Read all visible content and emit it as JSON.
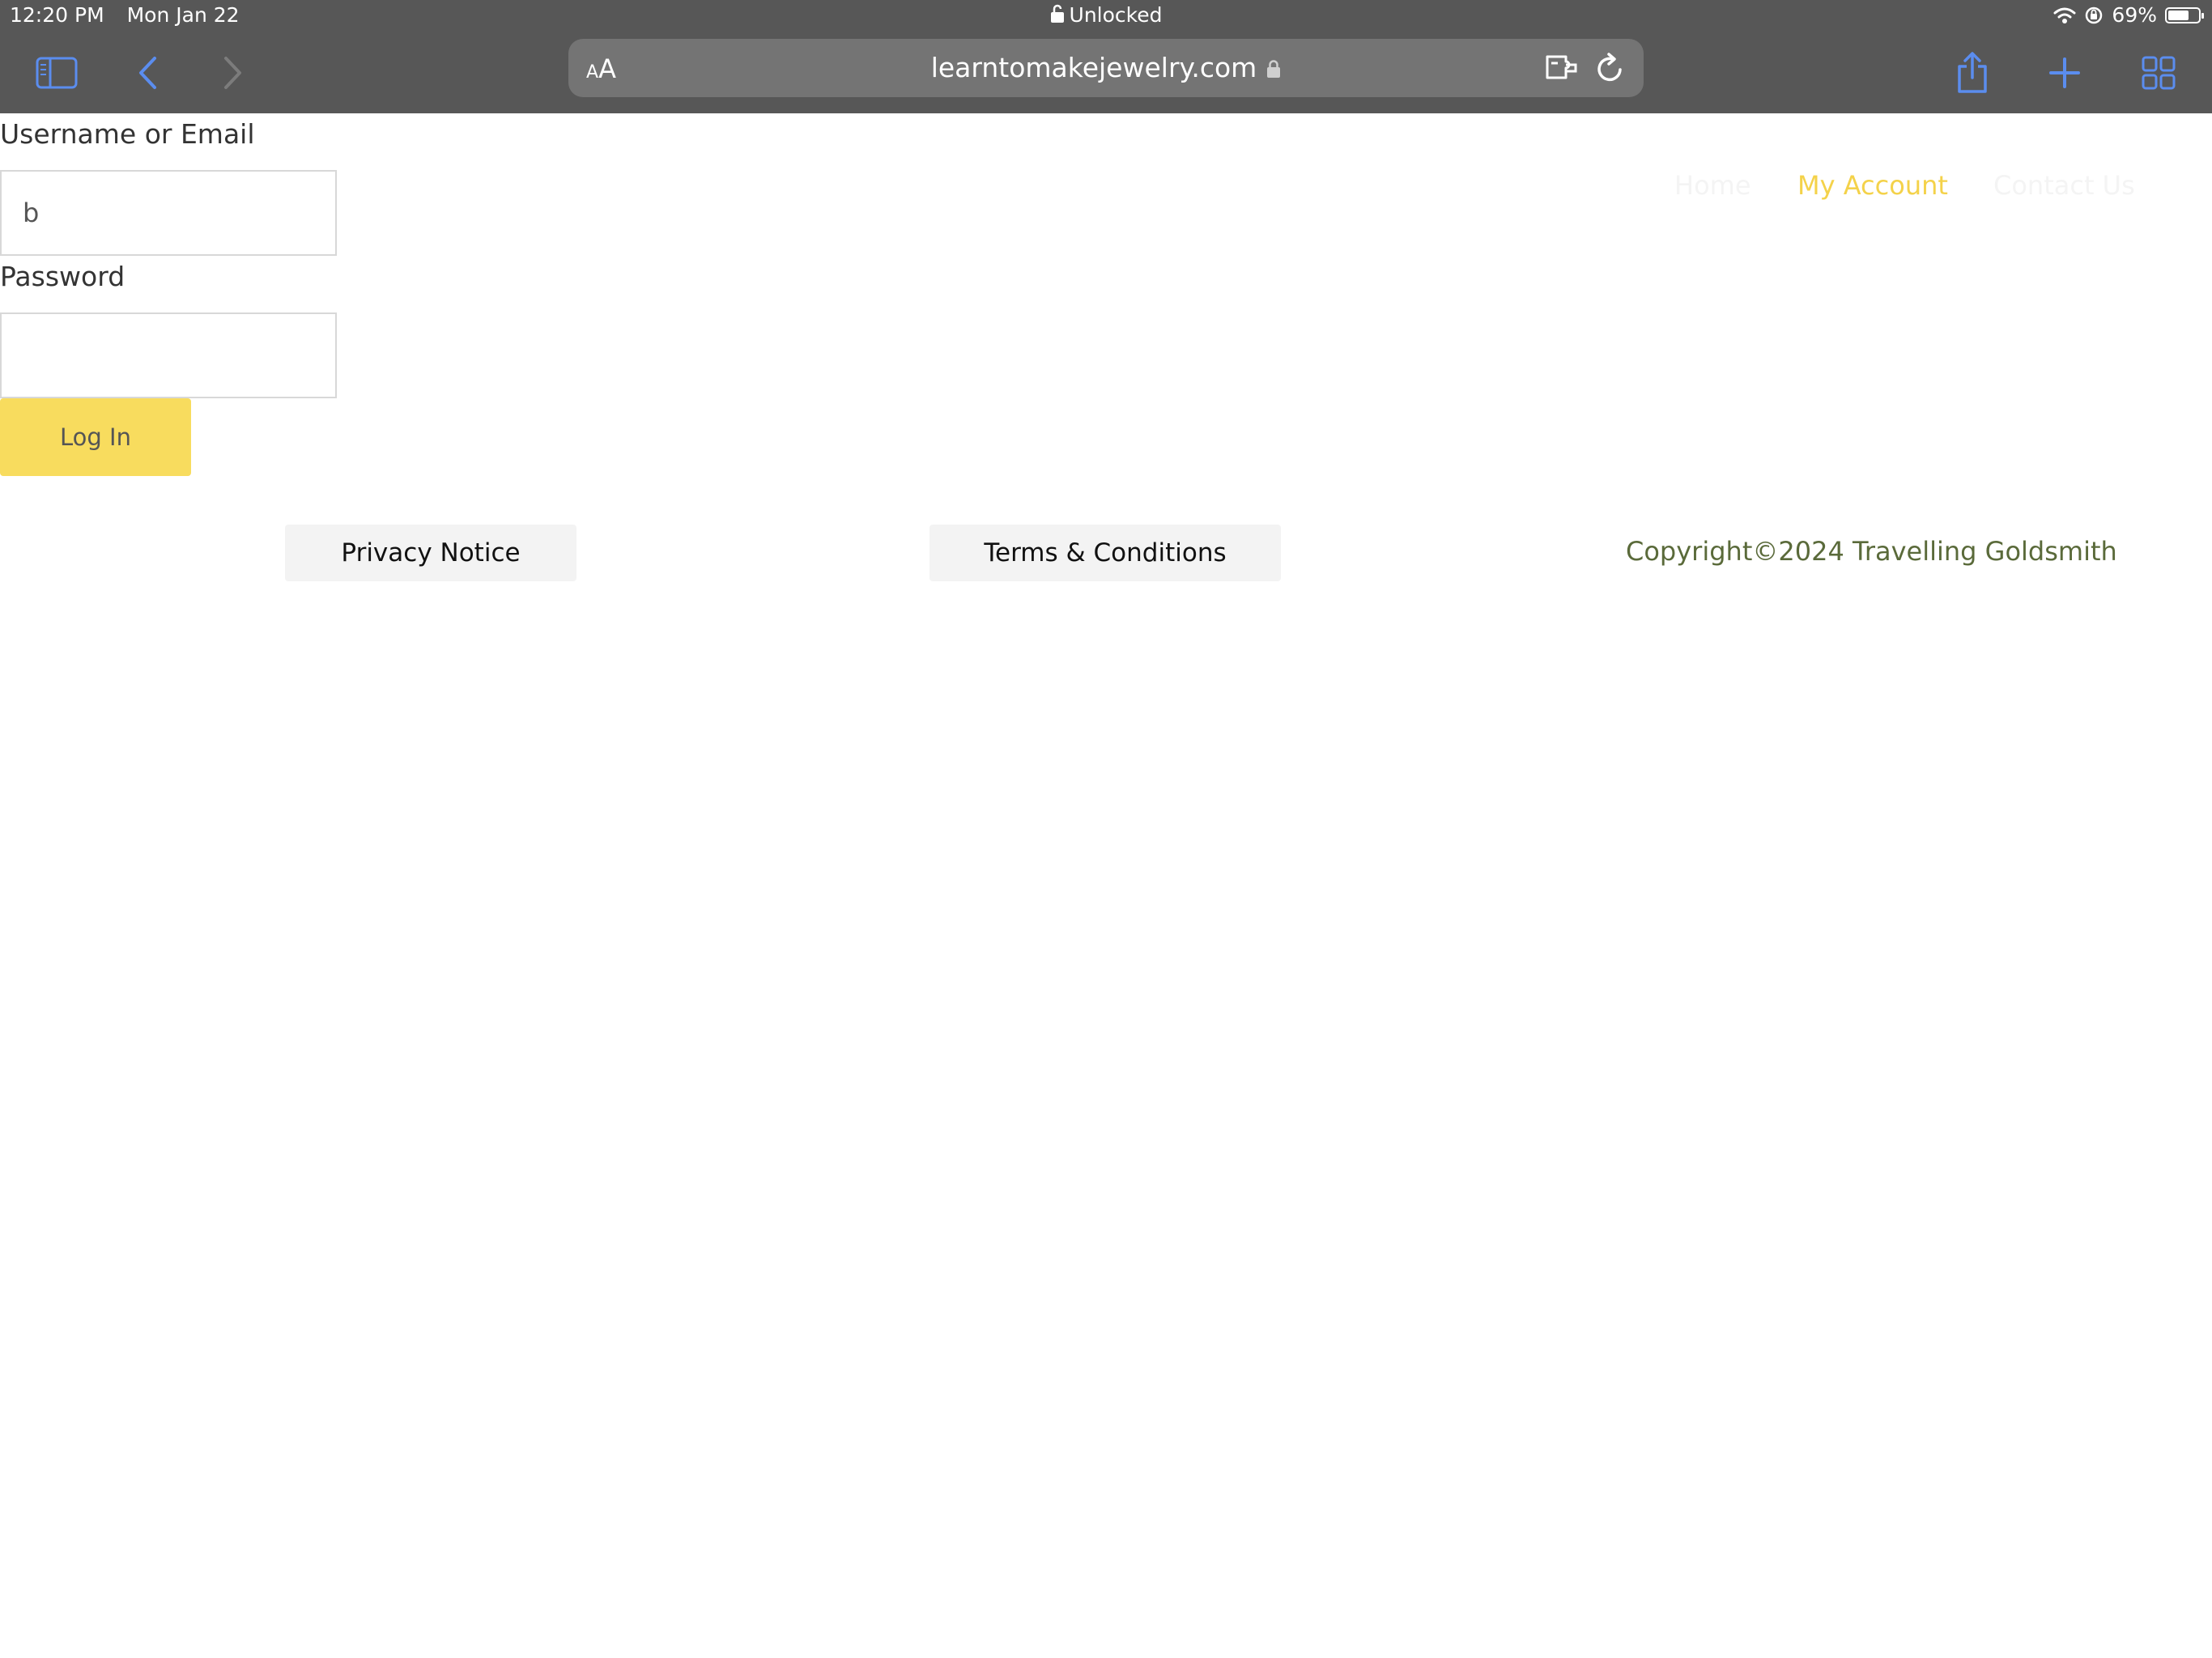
{
  "status_bar": {
    "time": "12:20 PM",
    "date": "Mon Jan 22",
    "lock_status": "Unlocked",
    "battery_percent": "69%",
    "battery_level": 0.69
  },
  "browser": {
    "url": "learntomakejewelry.com",
    "text_size_small": "A",
    "text_size_large": "A"
  },
  "nav": {
    "home": "Home",
    "my_account": "My Account",
    "contact_us": "Contact Us"
  },
  "login_form": {
    "username_label": "Username or Email",
    "username_value": "b",
    "password_label": "Password",
    "password_value": "",
    "login_button": "Log In"
  },
  "footer": {
    "privacy": "Privacy Notice",
    "terms": "Terms & Conditions",
    "copyright": "Copyright©2024 Travelling Goldsmith"
  }
}
